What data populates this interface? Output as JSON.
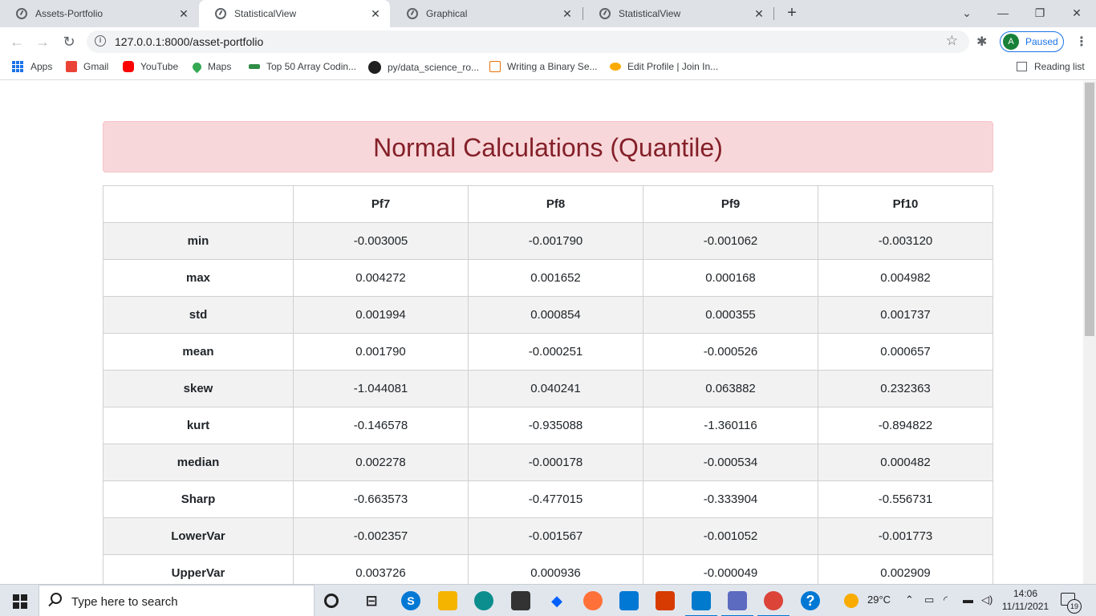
{
  "tabs": [
    {
      "title": "Assets-Portfolio",
      "close": "✕"
    },
    {
      "title": "StatisticalView",
      "close": "✕"
    },
    {
      "title": "Graphical",
      "close": "✕"
    },
    {
      "title": "StatisticalView",
      "close": "✕"
    }
  ],
  "new_tab": "+",
  "window_controls": {
    "dropdown": "⌄",
    "minimize": "—",
    "restore": "❐",
    "close": "✕"
  },
  "toolbar": {
    "back": "←",
    "forward": "→",
    "reload": "↻",
    "url": "127.0.0.1:8000/asset-portfolio",
    "star": "☆",
    "extensions": "✱",
    "profile_initial": "A",
    "profile_status": "Paused",
    "menu": "⋮"
  },
  "bookmarks": [
    {
      "label": "Apps",
      "icon": "apps-grid-icon"
    },
    {
      "label": "Gmail",
      "icon": "gmail-icon",
      "color": "#ea4335"
    },
    {
      "label": "YouTube",
      "icon": "youtube-icon",
      "color": "#ff0000"
    },
    {
      "label": "Maps",
      "icon": "maps-pin-icon",
      "color": "#34a853"
    },
    {
      "label": "Top 50 Array Codin...",
      "icon": "geeksforgeeks-icon",
      "color": "#2f8d46"
    },
    {
      "label": "py/data_science_ro...",
      "icon": "github-icon",
      "color": "#1f1f1f"
    },
    {
      "label": "Writing a Binary Se...",
      "icon": "search-page-icon",
      "color": "#e8710a"
    },
    {
      "label": "Edit Profile | Join In...",
      "icon": "handshake-icon",
      "color": "#f9ab00"
    }
  ],
  "reading_list": "Reading list",
  "page": {
    "title": "Normal Calculations (Quantile)",
    "table": {
      "headers": [
        "",
        "Pf7",
        "Pf8",
        "Pf9",
        "Pf10"
      ],
      "rows": [
        {
          "label": "min",
          "values": [
            "-0.003005",
            "-0.001790",
            "-0.001062",
            "-0.003120"
          ]
        },
        {
          "label": "max",
          "values": [
            "0.004272",
            "0.001652",
            "0.000168",
            "0.004982"
          ]
        },
        {
          "label": "std",
          "values": [
            "0.001994",
            "0.000854",
            "0.000355",
            "0.001737"
          ]
        },
        {
          "label": "mean",
          "values": [
            "0.001790",
            "-0.000251",
            "-0.000526",
            "0.000657"
          ]
        },
        {
          "label": "skew",
          "values": [
            "-1.044081",
            "0.040241",
            "0.063882",
            "0.232363"
          ]
        },
        {
          "label": "kurt",
          "values": [
            "-0.146578",
            "-0.935088",
            "-1.360116",
            "-0.894822"
          ]
        },
        {
          "label": "median",
          "values": [
            "0.002278",
            "-0.000178",
            "-0.000534",
            "0.000482"
          ]
        },
        {
          "label": "Sharp",
          "values": [
            "-0.663573",
            "-0.477015",
            "-0.333904",
            "-0.556731"
          ]
        },
        {
          "label": "LowerVar",
          "values": [
            "-0.002357",
            "-0.001567",
            "-0.001052",
            "-0.001773"
          ]
        },
        {
          "label": "UpperVar",
          "values": [
            "0.003726",
            "0.000936",
            "-0.000049",
            "0.002909"
          ]
        }
      ]
    }
  },
  "taskbar": {
    "search_placeholder": "Type here to search",
    "weather": "29°C",
    "time": "14:06",
    "date": "11/11/2021",
    "notifications": "19",
    "help": "?"
  },
  "colors": {
    "alert_bg": "#f8d7da",
    "alert_text": "#842029",
    "accent": "#1a73e8"
  }
}
